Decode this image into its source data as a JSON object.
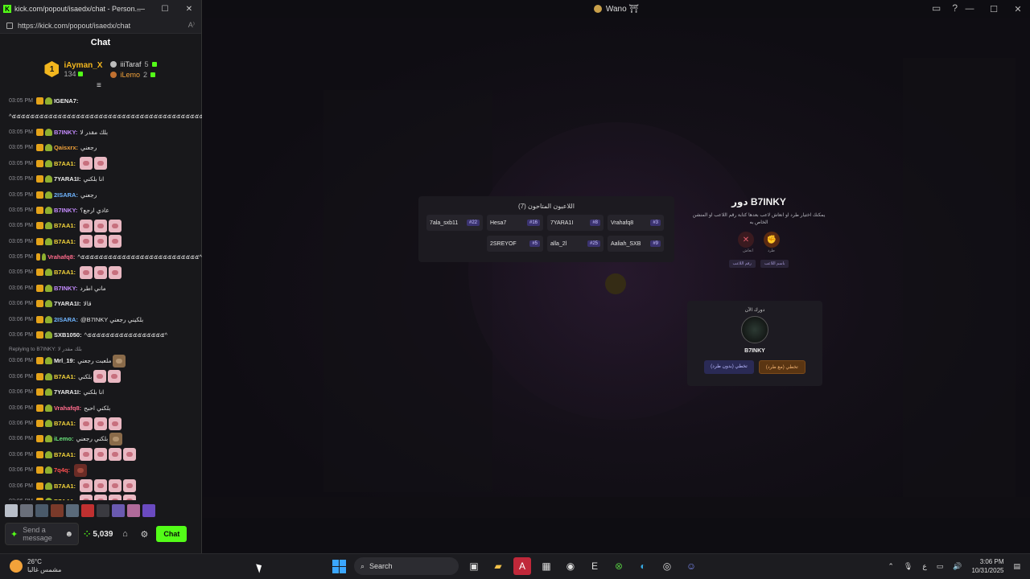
{
  "chat_window": {
    "title": "kick.com/popout/isaedx/chat - Person...",
    "url": "https://kick.com/popout/isaedx/chat",
    "header": "Chat",
    "leaderboard": {
      "first": {
        "rank": "1",
        "name": "iAyman_X",
        "count": "134"
      },
      "second": {
        "name": "iiiTaraf",
        "count": "5"
      },
      "third": {
        "name": "iLemo",
        "count": "2"
      }
    },
    "messages": [
      {
        "time": "03:05 PM",
        "user": "IGENA7:",
        "text": "",
        "color": "c-white",
        "partial": true
      },
      {
        "time": "",
        "user": "",
        "text": "^๕๕๕๕๕๕๕๕๕๕๕๕๕๕๕๕๕๕๕๕๕๕๕๕๕๕๕๕๕๕๕๕๕๕๕๕๕๕๕๕๕๕๕^",
        "color": "c-white"
      },
      {
        "time": "03:05 PM",
        "user": "B7INKY:",
        "text": "بلك مقدر لا",
        "color": "c-purple",
        "emotes": 0
      },
      {
        "time": "03:05 PM",
        "user": "Qaisxrx:",
        "text": "رجعني",
        "color": "c-orange",
        "emotes": 0
      },
      {
        "time": "03:05 PM",
        "user": "B7AA1:",
        "text": "",
        "color": "c-yellow",
        "emotes": 2
      },
      {
        "time": "03:05 PM",
        "user": "7YARA1I:",
        "text": "انا بلكني",
        "color": "c-white",
        "emotes": 0
      },
      {
        "time": "03:05 PM",
        "user": "2ISARA:",
        "text": "رجعني",
        "color": "c-blue",
        "emotes": 0
      },
      {
        "time": "03:05 PM",
        "user": "B7INKY:",
        "text": "عادي ارجع؟",
        "color": "c-purple",
        "emotes": 0
      },
      {
        "time": "03:05 PM",
        "user": "B7AA1:",
        "text": "",
        "color": "c-yellow",
        "emotes": 3
      },
      {
        "time": "03:05 PM",
        "user": "B7AA1:",
        "text": "",
        "color": "c-yellow",
        "emotes": 3
      },
      {
        "time": "03:05 PM",
        "user": "Vrahafq8:",
        "text": "^๕๕๕๕๕๕๕๕๕๕๕๕๕๕๕๕๕๕๕๕๕๕๕๕๕๕^",
        "color": "c-pink",
        "emotes": 0
      },
      {
        "time": "03:05 PM",
        "user": "B7AA1:",
        "text": "",
        "color": "c-yellow",
        "emotes": 3
      },
      {
        "time": "03:06 PM",
        "user": "B7INKY:",
        "text": "ماني اطرد",
        "color": "c-purple",
        "emotes": 0
      },
      {
        "time": "03:06 PM",
        "user": "7YARA1I:",
        "text": "قالا",
        "color": "c-white",
        "emotes": 0
      },
      {
        "time": "03:06 PM",
        "user": "2ISARA:",
        "text": "@B7INKY بلكيني رجعني",
        "color": "c-blue",
        "emotes": 0
      },
      {
        "time": "03:06 PM",
        "user": "SXB1050:",
        "text": "^๕๕๕๕๕๕๕๕๕๕๕๕๕๕๕๕๕^",
        "color": "c-white",
        "emotes": 0
      },
      {
        "time": "03:06 PM",
        "user": "Mrl_19:",
        "text": "ملعبت رجعني",
        "color": "c-white",
        "emotes": 1,
        "reply": "Replying to B7INKY: بلك مقدر لا"
      },
      {
        "time": "03:06 PM",
        "user": "B7AA1:",
        "text": "بلكني",
        "color": "c-yellow",
        "emotes": 2
      },
      {
        "time": "03:06 PM",
        "user": "7YARA1I:",
        "text": "انا بلكني",
        "color": "c-white",
        "emotes": 0
      },
      {
        "time": "03:06 PM",
        "user": "Vrahafq8:",
        "text": "بلكني احبح",
        "color": "c-pink",
        "emotes": 0
      },
      {
        "time": "03:06 PM",
        "user": "B7AA1:",
        "text": "",
        "color": "c-yellow",
        "emotes": 3
      },
      {
        "time": "03:06 PM",
        "user": "iLemo:",
        "text": "بلكني رجعني",
        "color": "c-green",
        "emotes": 1
      },
      {
        "time": "03:06 PM",
        "user": "B7AA1:",
        "text": "",
        "color": "c-yellow",
        "emotes": 4
      },
      {
        "time": "03:06 PM",
        "user": "7q4q:",
        "text": "",
        "color": "c-red",
        "emotes": 1
      },
      {
        "time": "03:06 PM",
        "user": "B7AA1:",
        "text": "",
        "color": "c-yellow",
        "emotes": 4
      },
      {
        "time": "03:06 PM",
        "user": "B7AA1:",
        "text": "",
        "color": "c-yellow",
        "emotes": 4
      }
    ],
    "input_placeholder": "Send a message",
    "points": "5,039",
    "send_label": "Chat"
  },
  "game": {
    "window_title": "Wano ⛩",
    "players_title": "اللاعبون المتاحون (7)",
    "players": [
      {
        "name": "Vrahafq8",
        "num": "#3"
      },
      {
        "name": "7YARA1I",
        "num": "#8"
      },
      {
        "name": "Hesa7",
        "num": "#16"
      },
      {
        "name": "7ala_sxb11",
        "num": "#22"
      },
      {
        "name": "Aaliah_SXB",
        "num": "#9"
      },
      {
        "name": "alla_2l",
        "num": "#25"
      },
      {
        "name": "2SREYOF",
        "num": "#5"
      }
    ],
    "turn_title": "دور B7INKY",
    "turn_subtitle": "يمكنك اختيار طرد او انعاش لاعب بعدها كتابة رقم اللاعب او المنشن الخاص به",
    "action_kick": "طرد",
    "action_revive": "انعاش",
    "tag_1": "باسم اللاعب",
    "tag_2": "رقم اللاعب",
    "current_label": "دورك الآن",
    "current_name": "B7INKY",
    "skip_with_kick": "تخطي (مع طرد)",
    "skip_without_kick": "تخطي (بدون طرد)"
  },
  "taskbar": {
    "temp": "26°C",
    "weather": "مشمس غالبا",
    "search": "Search",
    "lang": "ع",
    "time": "3:06 PM",
    "date": "10/31/2025"
  }
}
